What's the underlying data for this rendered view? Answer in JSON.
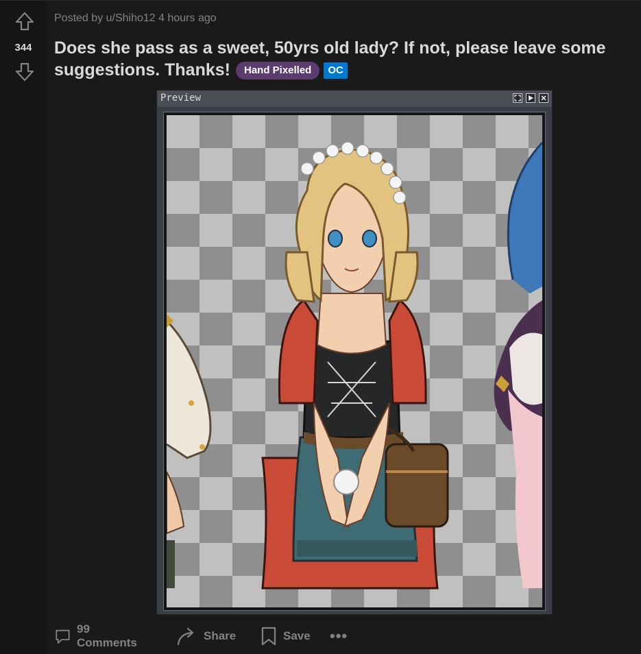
{
  "post": {
    "score": "344",
    "meta_prefix": "Posted by",
    "author": "u/Shiho12",
    "time": "4 hours ago",
    "title": "Does she pass as a sweet, 50yrs old lady? If not, please leave some suggestions. Thanks!",
    "flair": "Hand Pixelled",
    "oc_badge": "OC"
  },
  "preview": {
    "title": "Preview",
    "buttons": [
      "fit-icon",
      "play-icon",
      "close-icon"
    ]
  },
  "actions": {
    "comments": "99 Comments",
    "share": "Share",
    "save": "Save",
    "more": "•••"
  },
  "colors": {
    "background": "#1a1a1b",
    "vote_column": "#151516",
    "text_primary": "#d7dadc",
    "text_muted": "#818384",
    "flair_bg": "#5a3c6e",
    "oc_bg": "#0079d3"
  },
  "icons": {
    "upvote": "arrow-up-outline",
    "downvote": "arrow-down-outline",
    "comments": "speech-bubble",
    "share": "curved-arrow",
    "save": "bookmark"
  }
}
